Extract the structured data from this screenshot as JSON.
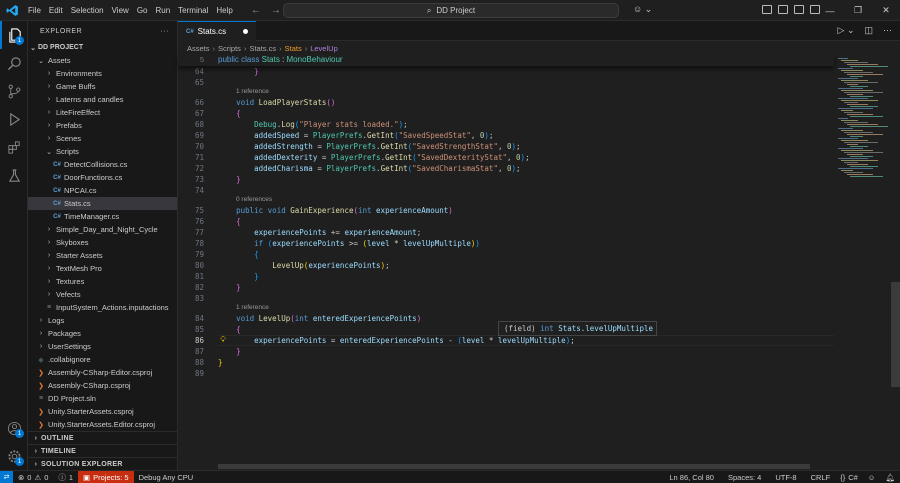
{
  "titlebar": {
    "menu": [
      "File",
      "Edit",
      "Selection",
      "View",
      "Go",
      "Run",
      "Terminal",
      "Help"
    ],
    "search_text": "DD Project",
    "back_icon": "arrow-left-icon",
    "forward_icon": "arrow-right-icon",
    "window_controls": [
      "minimize",
      "restore",
      "close"
    ]
  },
  "activity": {
    "items": [
      "explorer-icon",
      "search-icon",
      "source-control-icon",
      "run-debug-icon",
      "extensions-icon",
      "testing-icon"
    ],
    "explorer_badge": "1",
    "accounts_icon": "account-icon",
    "manage_icon": "gear-icon",
    "manage_badge": "1"
  },
  "sidebar": {
    "title": "EXPLORER",
    "project": "DD PROJECT",
    "tree": [
      {
        "label": "Assets",
        "depth": 1,
        "kind": "folder-open"
      },
      {
        "label": "Environments",
        "depth": 2,
        "kind": "folder"
      },
      {
        "label": "Game Buffs",
        "depth": 2,
        "kind": "folder"
      },
      {
        "label": "Laterns and candles",
        "depth": 2,
        "kind": "folder"
      },
      {
        "label": "LiteFireEffect",
        "depth": 2,
        "kind": "folder"
      },
      {
        "label": "Prefabs",
        "depth": 2,
        "kind": "folder"
      },
      {
        "label": "Scenes",
        "depth": 2,
        "kind": "folder"
      },
      {
        "label": "Scripts",
        "depth": 2,
        "kind": "folder-open"
      },
      {
        "label": "DetectCollisions.cs",
        "depth": 3,
        "kind": "cs"
      },
      {
        "label": "DoorFunctions.cs",
        "depth": 3,
        "kind": "cs"
      },
      {
        "label": "NPCAI.cs",
        "depth": 3,
        "kind": "cs"
      },
      {
        "label": "Stats.cs",
        "depth": 3,
        "kind": "cs",
        "selected": true
      },
      {
        "label": "TimeManager.cs",
        "depth": 3,
        "kind": "cs"
      },
      {
        "label": "Simple_Day_and_Night_Cycle",
        "depth": 2,
        "kind": "folder"
      },
      {
        "label": "Skyboxes",
        "depth": 2,
        "kind": "folder"
      },
      {
        "label": "Starter Assets",
        "depth": 2,
        "kind": "folder"
      },
      {
        "label": "TextMesh Pro",
        "depth": 2,
        "kind": "folder"
      },
      {
        "label": "Textures",
        "depth": 2,
        "kind": "folder"
      },
      {
        "label": "Vefects",
        "depth": 2,
        "kind": "folder"
      },
      {
        "label": "InputSystem_Actions.inputactions",
        "depth": 2,
        "kind": "file"
      },
      {
        "label": "Logs",
        "depth": 1,
        "kind": "folder"
      },
      {
        "label": "Packages",
        "depth": 1,
        "kind": "folder"
      },
      {
        "label": "UserSettings",
        "depth": 1,
        "kind": "folder"
      },
      {
        "label": ".collabignore",
        "depth": 1,
        "kind": "ignore"
      },
      {
        "label": "Assembly-CSharp-Editor.csproj",
        "depth": 1,
        "kind": "xml"
      },
      {
        "label": "Assembly-CSharp.csproj",
        "depth": 1,
        "kind": "xml"
      },
      {
        "label": "DD Project.sln",
        "depth": 1,
        "kind": "file"
      },
      {
        "label": "Unity.StarterAssets.csproj",
        "depth": 1,
        "kind": "xml"
      },
      {
        "label": "Unity.StarterAssets.Editor.csproj",
        "depth": 1,
        "kind": "xml"
      }
    ],
    "sections": [
      "OUTLINE",
      "TIMELINE",
      "SOLUTION EXPLORER"
    ]
  },
  "tabs": [
    {
      "label": "Stats.cs",
      "modified": true
    }
  ],
  "breadcrumb": [
    "Assets",
    "Scripts",
    "Stats.cs",
    "Stats",
    "LevelUp"
  ],
  "editor": {
    "sticky": {
      "line": 5,
      "text": "public class Stats : MonoBehaviour"
    },
    "lines": [
      {
        "n": 64,
        "tokens": [
          [
            "        ",
            ""
          ],
          [
            "}",
            "br2"
          ]
        ]
      },
      {
        "n": 65,
        "tokens": []
      },
      {
        "lens": "1 reference"
      },
      {
        "n": 66,
        "tokens": [
          [
            "    ",
            ""
          ],
          [
            "void",
            "kw"
          ],
          [
            " ",
            ""
          ],
          [
            "LoadPlayerStats",
            "fn"
          ],
          [
            "()",
            "br2"
          ]
        ]
      },
      {
        "n": 67,
        "tokens": [
          [
            "    ",
            ""
          ],
          [
            "{",
            "br2"
          ]
        ]
      },
      {
        "n": 68,
        "tokens": [
          [
            "        ",
            ""
          ],
          [
            "Debug",
            "ty"
          ],
          [
            ".",
            ""
          ],
          [
            "Log",
            "fn"
          ],
          [
            "(",
            "br3"
          ],
          [
            "\"Player stats loaded.\"",
            "str"
          ],
          [
            ")",
            "br3"
          ],
          [
            ";",
            ""
          ]
        ]
      },
      {
        "n": 69,
        "tokens": [
          [
            "        ",
            ""
          ],
          [
            "addedSpeed",
            "var"
          ],
          [
            " = ",
            ""
          ],
          [
            "PlayerPrefs",
            "ty"
          ],
          [
            ".",
            ""
          ],
          [
            "GetInt",
            "fn"
          ],
          [
            "(",
            "br3"
          ],
          [
            "\"SavedSpeedStat\"",
            "str"
          ],
          [
            ", ",
            ""
          ],
          [
            "0",
            "num"
          ],
          [
            ")",
            "br3"
          ],
          [
            ";",
            ""
          ]
        ]
      },
      {
        "n": 70,
        "tokens": [
          [
            "        ",
            ""
          ],
          [
            "addedStrength",
            "var"
          ],
          [
            " = ",
            ""
          ],
          [
            "PlayerPrefs",
            "ty"
          ],
          [
            ".",
            ""
          ],
          [
            "GetInt",
            "fn"
          ],
          [
            "(",
            "br3"
          ],
          [
            "\"SavedStrengthStat\"",
            "str"
          ],
          [
            ", ",
            ""
          ],
          [
            "0",
            "num"
          ],
          [
            ")",
            "br3"
          ],
          [
            ";",
            ""
          ]
        ]
      },
      {
        "n": 71,
        "tokens": [
          [
            "        ",
            ""
          ],
          [
            "addedDexterity",
            "var"
          ],
          [
            " = ",
            ""
          ],
          [
            "PlayerPrefs",
            "ty"
          ],
          [
            ".",
            ""
          ],
          [
            "GetInt",
            "fn"
          ],
          [
            "(",
            "br3"
          ],
          [
            "\"SavedDexterityStat\"",
            "str"
          ],
          [
            ", ",
            ""
          ],
          [
            "0",
            "num"
          ],
          [
            ")",
            "br3"
          ],
          [
            ";",
            ""
          ]
        ]
      },
      {
        "n": 72,
        "tokens": [
          [
            "        ",
            ""
          ],
          [
            "addedCharisma",
            "var"
          ],
          [
            " = ",
            ""
          ],
          [
            "PlayerPrefs",
            "ty"
          ],
          [
            ".",
            ""
          ],
          [
            "GetInt",
            "fn"
          ],
          [
            "(",
            "br3"
          ],
          [
            "\"SavedCharismaStat\"",
            "str"
          ],
          [
            ", ",
            ""
          ],
          [
            "0",
            "num"
          ],
          [
            ")",
            "br3"
          ],
          [
            ";",
            ""
          ]
        ]
      },
      {
        "n": 73,
        "tokens": [
          [
            "    ",
            ""
          ],
          [
            "}",
            "br2"
          ]
        ]
      },
      {
        "n": 74,
        "tokens": []
      },
      {
        "lens": "0 references"
      },
      {
        "n": 75,
        "tokens": [
          [
            "    ",
            ""
          ],
          [
            "public",
            "kw"
          ],
          [
            " ",
            ""
          ],
          [
            "void",
            "kw"
          ],
          [
            " ",
            ""
          ],
          [
            "GainExperience",
            "fn"
          ],
          [
            "(",
            "br2"
          ],
          [
            "int",
            "kw"
          ],
          [
            " ",
            ""
          ],
          [
            "experienceAmount",
            "var"
          ],
          [
            ")",
            "br2"
          ]
        ]
      },
      {
        "n": 76,
        "tokens": [
          [
            "    ",
            ""
          ],
          [
            "{",
            "br2"
          ]
        ]
      },
      {
        "n": 77,
        "tokens": [
          [
            "        ",
            ""
          ],
          [
            "experiencePoints",
            "var"
          ],
          [
            " += ",
            ""
          ],
          [
            "experienceAmount",
            "var"
          ],
          [
            ";",
            ""
          ]
        ]
      },
      {
        "n": 78,
        "tokens": [
          [
            "        ",
            ""
          ],
          [
            "if",
            "kw"
          ],
          [
            " ",
            ""
          ],
          [
            "(",
            "br3"
          ],
          [
            "experiencePoints",
            "var"
          ],
          [
            " >= ",
            ""
          ],
          [
            "(",
            "br1"
          ],
          [
            "level",
            "var"
          ],
          [
            " * ",
            ""
          ],
          [
            "levelUpMultiple",
            "var"
          ],
          [
            ")",
            "br1"
          ],
          [
            ")",
            "br3"
          ]
        ]
      },
      {
        "n": 79,
        "tokens": [
          [
            "        ",
            ""
          ],
          [
            "{",
            "br3"
          ]
        ]
      },
      {
        "n": 80,
        "tokens": [
          [
            "            ",
            ""
          ],
          [
            "LevelUp",
            "fn"
          ],
          [
            "(",
            "br1"
          ],
          [
            "experiencePoints",
            "var"
          ],
          [
            ")",
            "br1"
          ],
          [
            ";",
            ""
          ]
        ]
      },
      {
        "n": 81,
        "tokens": [
          [
            "        ",
            ""
          ],
          [
            "}",
            "br3"
          ]
        ]
      },
      {
        "n": 82,
        "tokens": [
          [
            "    ",
            ""
          ],
          [
            "}",
            "br2"
          ]
        ]
      },
      {
        "n": 83,
        "tokens": []
      },
      {
        "lens": "1 reference"
      },
      {
        "n": 84,
        "tokens": [
          [
            "    ",
            ""
          ],
          [
            "void",
            "kw"
          ],
          [
            " ",
            ""
          ],
          [
            "LevelUp",
            "fn"
          ],
          [
            "(",
            "br2"
          ],
          [
            "int",
            "kw"
          ],
          [
            " ",
            ""
          ],
          [
            "enteredExperiencePoints",
            "var"
          ],
          [
            ")",
            "br2"
          ]
        ]
      },
      {
        "n": 85,
        "tokens": [
          [
            "    ",
            ""
          ],
          [
            "{",
            "br2"
          ]
        ]
      },
      {
        "n": 86,
        "current": true,
        "tokens": [
          [
            "        ",
            ""
          ],
          [
            "experiencePoints",
            "var"
          ],
          [
            " = ",
            ""
          ],
          [
            "enteredExperiencePoints",
            "var"
          ],
          [
            " - ",
            ""
          ],
          [
            "(",
            "br3"
          ],
          [
            "level",
            "var"
          ],
          [
            " * ",
            ""
          ],
          [
            "levelUpMultiple",
            "var"
          ],
          [
            ")",
            "br3"
          ],
          [
            ";",
            ""
          ]
        ]
      },
      {
        "n": 87,
        "tokens": [
          [
            "    ",
            ""
          ],
          [
            "}",
            "br2"
          ]
        ]
      },
      {
        "n": 88,
        "tokens": [
          [
            "}",
            "br1"
          ]
        ]
      },
      {
        "n": 89,
        "tokens": []
      }
    ],
    "hover": {
      "kind": "(field)",
      "type": "int",
      "name": "Stats.levelUpMultiple"
    },
    "lightbulb_icon": "lightbulb-icon"
  },
  "status": {
    "remote_icon": "remote-icon",
    "errors": "0",
    "warnings": "0",
    "info": "1",
    "projects": "Projects: 5",
    "debug": "Debug Any CPU",
    "position": "Ln 86, Col 80",
    "spaces": "Spaces: 4",
    "encoding": "UTF-8",
    "eol": "CRLF",
    "language": "C#",
    "notifications_icon": "bell-icon"
  }
}
